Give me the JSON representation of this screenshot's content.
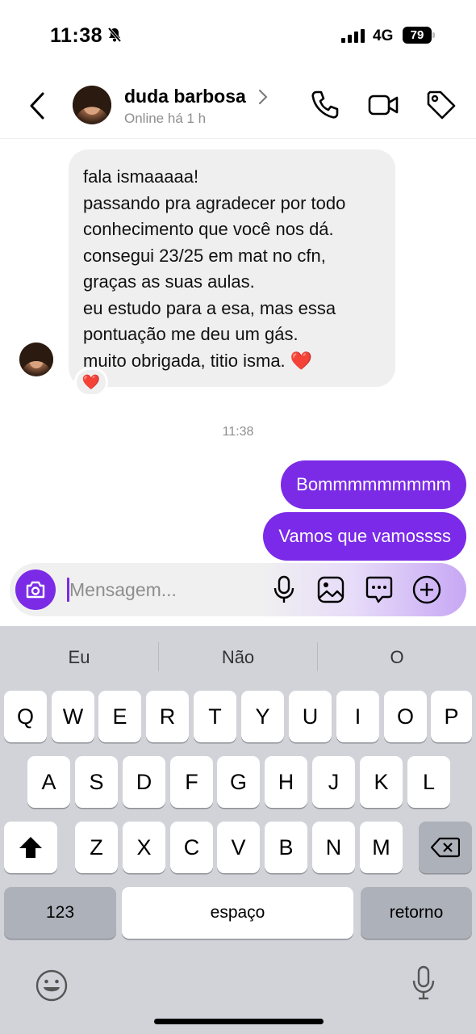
{
  "status_bar": {
    "time": "11:38",
    "network": "4G",
    "battery": "79"
  },
  "header": {
    "contact_name": "duda barbosa",
    "online_status": "Online há 1 h"
  },
  "messages": {
    "incoming_lines": [
      "fala ismaaaaa!",
      "passando pra agradecer por todo",
      "conhecimento que você nos dá.",
      "consegui 23/25 em mat no cfn,",
      "graças as suas aulas.",
      "eu estudo para a esa, mas essa",
      "pontuação me deu um gás.",
      "muito obrigada, titio isma. ❤️"
    ],
    "reaction": "❤️",
    "timestamp": "11:38",
    "outgoing": [
      "Bommmmmmmmm",
      "Vamos que vamossss"
    ]
  },
  "composer": {
    "placeholder": "Mensagem..."
  },
  "keyboard": {
    "suggestions": [
      "Eu",
      "Não",
      "O"
    ],
    "row1": [
      "Q",
      "W",
      "E",
      "R",
      "T",
      "Y",
      "U",
      "I",
      "O",
      "P"
    ],
    "row2": [
      "A",
      "S",
      "D",
      "F",
      "G",
      "H",
      "J",
      "K",
      "L"
    ],
    "row3": [
      "Z",
      "X",
      "C",
      "V",
      "B",
      "N",
      "M"
    ],
    "numbers_label": "123",
    "space_label": "espaço",
    "return_label": "retorno"
  },
  "colors": {
    "accent": "#7b2be6",
    "incoming_bubble": "#efefef",
    "keyboard_bg": "#d1d3d9"
  }
}
